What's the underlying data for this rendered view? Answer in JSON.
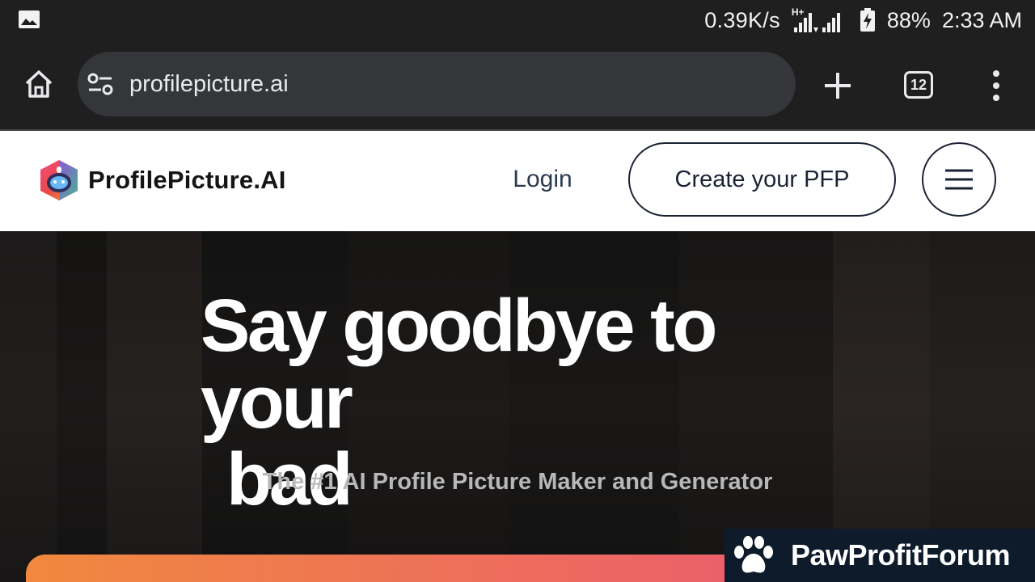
{
  "status_bar": {
    "net_speed": "0.39K/s",
    "network_type": "H+",
    "battery": "88%",
    "time": "2:33 AM",
    "icons": [
      "gallery-icon",
      "signal-icon",
      "battery-charging-icon"
    ]
  },
  "browser": {
    "url": "profilepicture.ai",
    "tab_count": "12",
    "icons": [
      "home-icon",
      "site-settings-icon",
      "new-tab-icon",
      "tab-switcher-icon",
      "more-menu-icon"
    ]
  },
  "site_header": {
    "brand_name": "ProfilePicture.AI",
    "login_label": "Login",
    "cta_label": "Create your PFP",
    "menu_icon": "hamburger-icon"
  },
  "hero": {
    "title_line1": "Say goodbye to your",
    "title_line2": "bad",
    "subtitle": "The #1 AI Profile Picture Maker and Generator"
  },
  "watermark": {
    "text": "PawProfitForum",
    "icon": "paw-icon"
  },
  "colors": {
    "chrome_bg": "#1f1f1f",
    "omnibox_bg": "#35363a",
    "header_text": "#1a2233",
    "gradient_start": "#f0893f",
    "gradient_end": "#e9507a",
    "watermark_bg": "#0d1b2a"
  }
}
